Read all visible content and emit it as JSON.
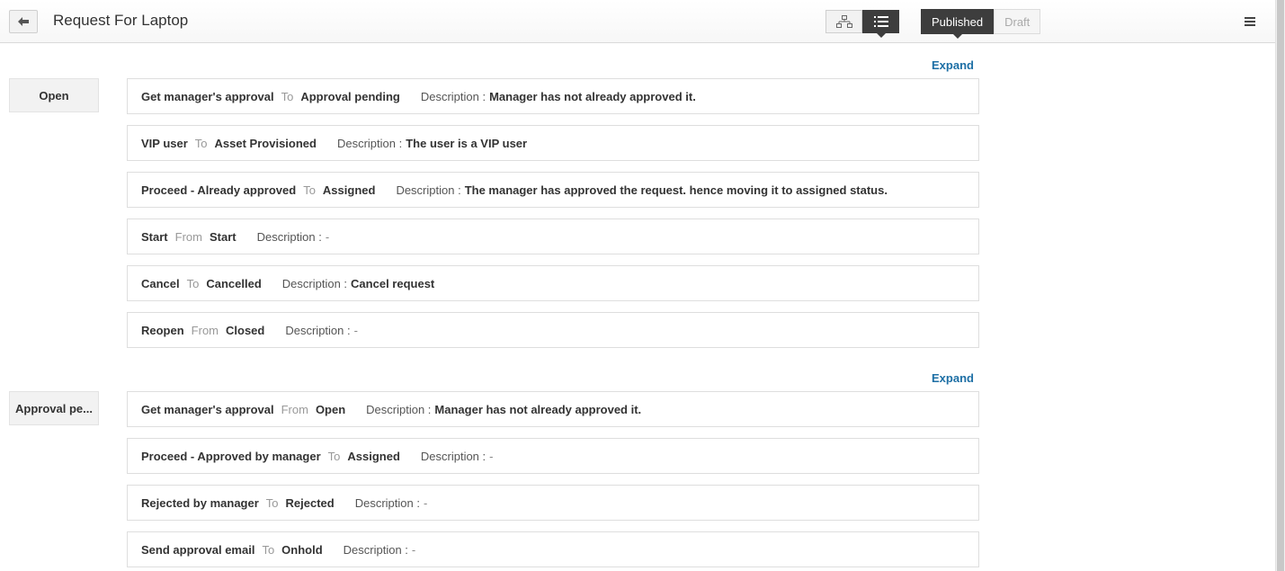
{
  "header": {
    "title": "Request For Laptop",
    "view_toggle": [
      "flowchart-view",
      "list-view"
    ],
    "publish_toggle": {
      "published_label": "Published",
      "draft_label": "Draft"
    }
  },
  "groups": [
    {
      "state": "Open",
      "expand_label": "Expand",
      "transitions": [
        {
          "name": "Get manager's approval",
          "direction": "To",
          "target": "Approval pending",
          "desc_label": "Description :",
          "desc": "Manager has not already approved it."
        },
        {
          "name": "VIP user",
          "direction": "To",
          "target": "Asset Provisioned",
          "desc_label": "Description :",
          "desc": "The user is a VIP user"
        },
        {
          "name": "Proceed - Already approved",
          "direction": "To",
          "target": "Assigned",
          "desc_label": "Description :",
          "desc": "The manager has approved the request. hence moving it to assigned status."
        },
        {
          "name": "Start",
          "direction": "From",
          "target": "Start",
          "desc_label": "Description :",
          "desc": "-"
        },
        {
          "name": "Cancel",
          "direction": "To",
          "target": "Cancelled",
          "desc_label": "Description :",
          "desc": "Cancel request"
        },
        {
          "name": "Reopen",
          "direction": "From",
          "target": "Closed",
          "desc_label": "Description :",
          "desc": "-"
        }
      ]
    },
    {
      "state": "Approval pe...",
      "expand_label": "Expand",
      "transitions": [
        {
          "name": "Get manager's approval",
          "direction": "From",
          "target": "Open",
          "desc_label": "Description :",
          "desc": "Manager has not already approved it."
        },
        {
          "name": "Proceed - Approved by manager",
          "direction": "To",
          "target": "Assigned",
          "desc_label": "Description :",
          "desc": "-"
        },
        {
          "name": "Rejected by manager",
          "direction": "To",
          "target": "Rejected",
          "desc_label": "Description :",
          "desc": "-"
        },
        {
          "name": "Send approval email",
          "direction": "To",
          "target": "Onhold",
          "desc_label": "Description :",
          "desc": "-"
        }
      ]
    }
  ]
}
